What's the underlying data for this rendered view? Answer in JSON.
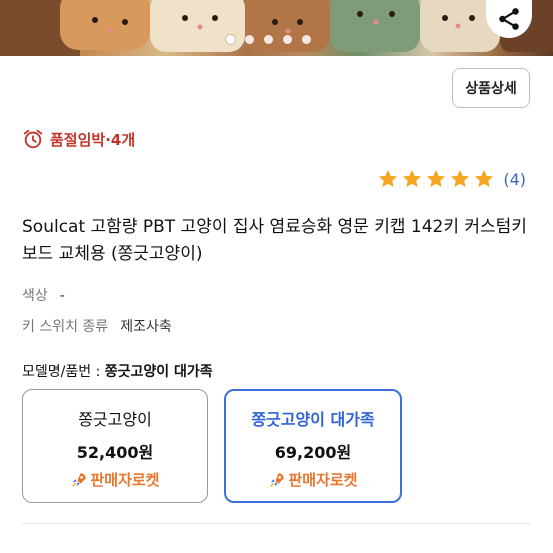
{
  "share": {
    "icon": "share-icon"
  },
  "carousel": {
    "dots": 5,
    "active_index": 0
  },
  "detail_button": {
    "label": "상품상세"
  },
  "soldout": {
    "icon": "alarm-clock-icon",
    "text": "품절임박·4개",
    "color": "#c0352b"
  },
  "rating": {
    "stars": 5,
    "count": "(4)",
    "star_color": "#f5a623"
  },
  "product": {
    "title": "Soulcat 고함량 PBT 고양이 집사 염료승화 영문 키캡 142키 커스텀키보드 교체용 (쫑긋고양이)"
  },
  "specs": [
    {
      "label": "색상",
      "value": "-"
    },
    {
      "label": "키 스위치 종류",
      "value": "제조사축"
    }
  ],
  "model": {
    "label": "모델명/품번 : ",
    "value": "쫑긋고양이 대가족"
  },
  "options": [
    {
      "name": "쫑긋고양이",
      "price": "52,400원",
      "badge": "판매자로켓",
      "badge_icon": "rocket-icon",
      "selected": false
    },
    {
      "name": "쫑긋고양이 대가족",
      "price": "69,200원",
      "badge": "판매자로켓",
      "badge_icon": "rocket-icon",
      "selected": true
    }
  ],
  "colors": {
    "accent": "#3d6fe0",
    "rocket": "#e8772e",
    "link": "#3a66c4"
  }
}
